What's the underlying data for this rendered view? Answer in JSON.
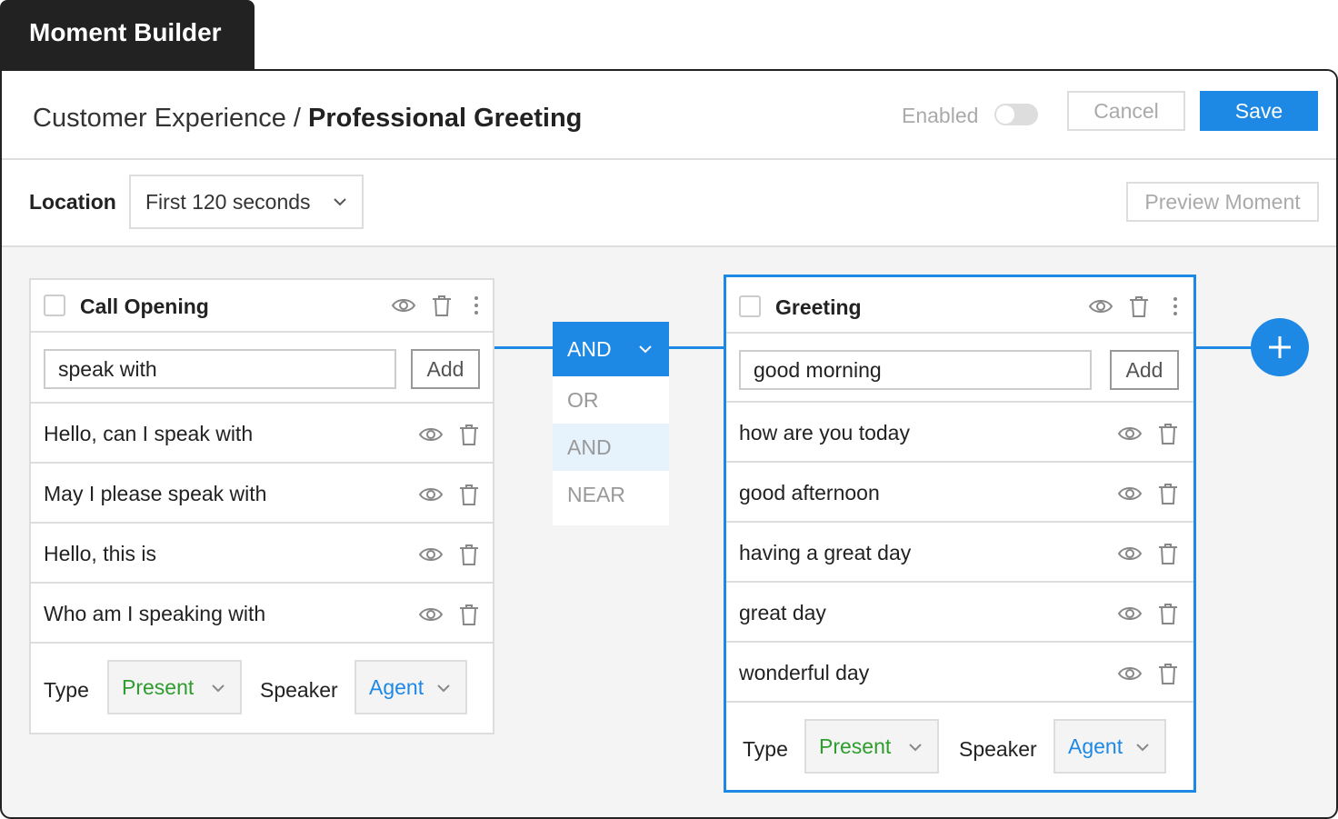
{
  "app": {
    "tab_title": "Moment Builder"
  },
  "header": {
    "breadcrumb_parent": "Customer Experience / ",
    "breadcrumb_current": "Professional Greeting",
    "enabled_label": "Enabled",
    "enabled_on": false,
    "cancel_label": "Cancel",
    "save_label": "Save"
  },
  "location": {
    "label": "Location",
    "selected": "First 120 seconds",
    "preview_label": "Preview Moment"
  },
  "operator": {
    "selected": "AND",
    "options": [
      "OR",
      "AND",
      "NEAR"
    ]
  },
  "groups": [
    {
      "title": "Call Opening",
      "input_value": "speak with",
      "add_label": "Add",
      "phrases": [
        "Hello, can I speak with",
        "May I please speak with",
        "Hello, this is",
        "Who am I speaking with"
      ],
      "type_label": "Type",
      "type_value": "Present",
      "speaker_label": "Speaker",
      "speaker_value": "Agent"
    },
    {
      "title": "Greeting",
      "input_value": "good morning",
      "add_label": "Add",
      "phrases": [
        "how are you today",
        "good afternoon",
        "having a great day",
        "great day",
        "wonderful day"
      ],
      "type_label": "Type",
      "type_value": "Present",
      "speaker_label": "Speaker",
      "speaker_value": "Agent"
    }
  ],
  "colors": {
    "accent": "#1e88e5",
    "present": "#2e9d2e",
    "dark": "#222222"
  },
  "icons": [
    "eye-icon",
    "trash-icon",
    "more-vertical-icon",
    "chevron-down-icon",
    "plus-icon"
  ]
}
